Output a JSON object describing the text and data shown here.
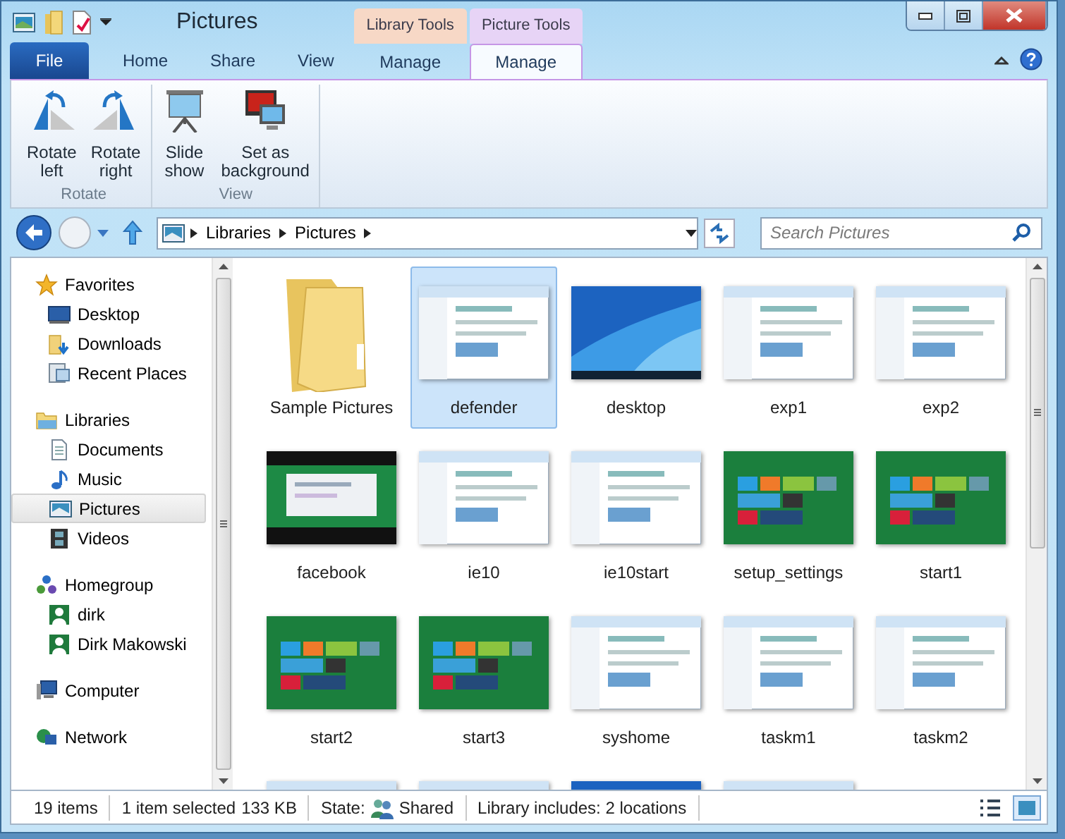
{
  "window": {
    "title": "Pictures"
  },
  "ribbon_tabs": [
    {
      "label": "File",
      "kind": "file",
      "selected": false
    },
    {
      "label": "Home",
      "kind": "tab",
      "selected": false
    },
    {
      "label": "Share",
      "kind": "tab",
      "selected": false
    },
    {
      "label": "View",
      "kind": "tab",
      "selected": false
    }
  ],
  "context_tabs": [
    {
      "label": "Library Tools",
      "color": "#f7d8c6",
      "tabs": [
        {
          "label": "Manage",
          "selected": false
        }
      ]
    },
    {
      "label": "Picture Tools",
      "color": "#e7d4f6",
      "tabs": [
        {
          "label": "Manage",
          "selected": true
        }
      ]
    }
  ],
  "ribbon_groups": [
    {
      "label": "Rotate",
      "buttons": [
        {
          "label": "Rotate\nleft"
        },
        {
          "label": "Rotate\nright"
        }
      ]
    },
    {
      "label": "View",
      "buttons": [
        {
          "label": "Slide\nshow"
        },
        {
          "label": "Set as\nbackground"
        }
      ]
    }
  ],
  "address": {
    "crumbs": [
      "Libraries",
      "Pictures"
    ]
  },
  "search": {
    "placeholder": "Search Pictures"
  },
  "sidebar": [
    {
      "label": "Favorites",
      "selected": false,
      "children": [
        {
          "label": "Desktop",
          "selected": false
        },
        {
          "label": "Downloads",
          "selected": false
        },
        {
          "label": "Recent Places",
          "selected": false
        }
      ]
    },
    {
      "label": "Libraries",
      "selected": false,
      "children": [
        {
          "label": "Documents",
          "selected": false
        },
        {
          "label": "Music",
          "selected": false
        },
        {
          "label": "Pictures",
          "selected": true
        },
        {
          "label": "Videos",
          "selected": false
        }
      ]
    },
    {
      "label": "Homegroup",
      "selected": false,
      "children": [
        {
          "label": "dirk",
          "selected": false
        },
        {
          "label": "Dirk Makowski",
          "selected": false
        }
      ]
    },
    {
      "label": "Computer",
      "selected": false
    },
    {
      "label": "Network",
      "selected": false
    }
  ],
  "files": [
    {
      "label": "Sample Pictures",
      "kind": "folder",
      "selected": false
    },
    {
      "label": "defender",
      "kind": "picture",
      "selected": true
    },
    {
      "label": "desktop",
      "kind": "picture",
      "selected": false
    },
    {
      "label": "exp1",
      "kind": "picture",
      "selected": false
    },
    {
      "label": "exp2",
      "kind": "picture",
      "selected": false
    },
    {
      "label": "facebook",
      "kind": "picture",
      "selected": false
    },
    {
      "label": "ie10",
      "kind": "picture",
      "selected": false
    },
    {
      "label": "ie10start",
      "kind": "picture",
      "selected": false
    },
    {
      "label": "setup_settings",
      "kind": "picture",
      "selected": false
    },
    {
      "label": "start1",
      "kind": "picture",
      "selected": false
    },
    {
      "label": "start2",
      "kind": "picture",
      "selected": false
    },
    {
      "label": "start3",
      "kind": "picture",
      "selected": false
    },
    {
      "label": "syshome",
      "kind": "picture",
      "selected": false
    },
    {
      "label": "taskm1",
      "kind": "picture",
      "selected": false
    },
    {
      "label": "taskm2",
      "kind": "picture",
      "selected": false
    },
    {
      "kind": "picture",
      "selected": false
    },
    {
      "kind": "picture",
      "selected": false
    },
    {
      "kind": "picture",
      "selected": false
    },
    {
      "kind": "picture",
      "selected": false
    }
  ],
  "status_bar": {
    "item_count": "19 items",
    "selection": "1 item selected",
    "size": "133 KB",
    "state_label": "State:",
    "state_value": "Shared",
    "library": "Library includes: 2 locations"
  }
}
